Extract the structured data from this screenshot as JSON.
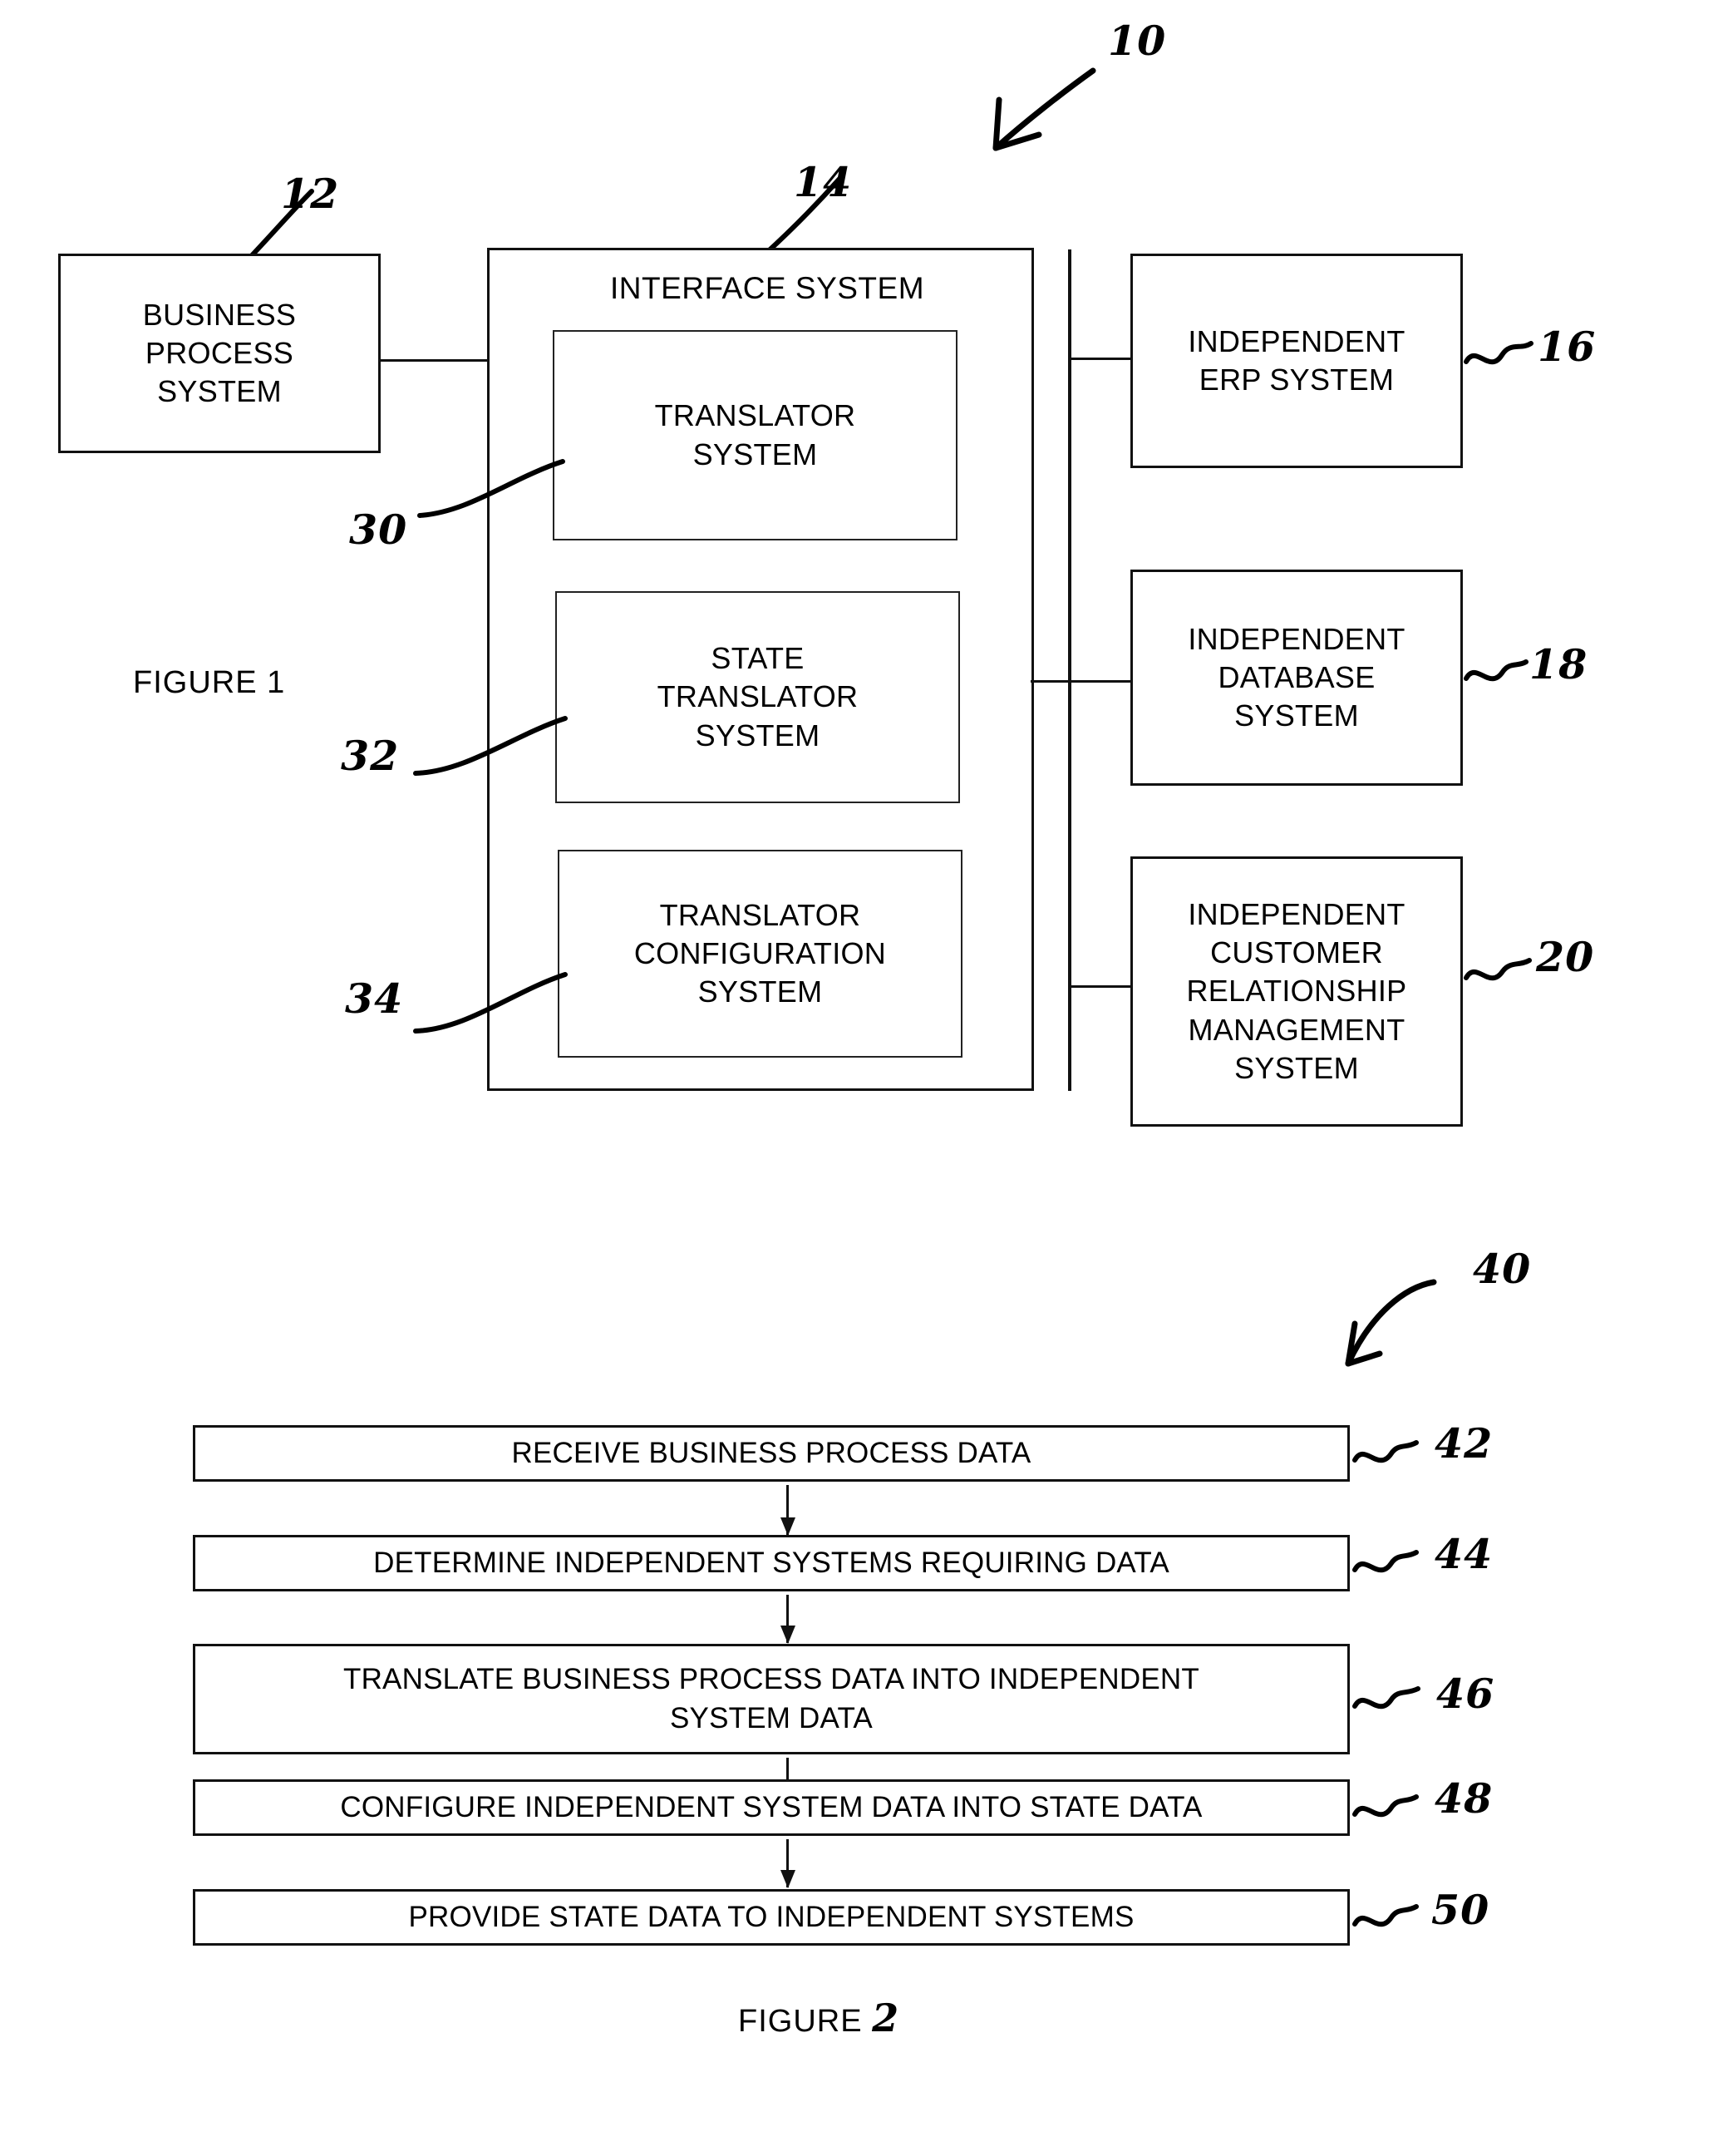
{
  "figure1": {
    "caption": "FIGURE 1",
    "system_ref": "10",
    "blocks": {
      "business_process": {
        "label": "BUSINESS\nPROCESS\nSYSTEM",
        "ref": "12"
      },
      "interface_system": {
        "title": "INTERFACE SYSTEM",
        "ref": "14"
      },
      "translator_system": {
        "label": "TRANSLATOR\nSYSTEM",
        "ref": "30"
      },
      "state_translator_system": {
        "label": "STATE\nTRANSLATOR\nSYSTEM",
        "ref": "32"
      },
      "translator_configuration_system": {
        "label": "TRANSLATOR\nCONFIGURATION\nSYSTEM",
        "ref": "34"
      },
      "independent_erp": {
        "label": "INDEPENDENT\nERP SYSTEM",
        "ref": "16"
      },
      "independent_database": {
        "label": "INDEPENDENT\nDATABASE\nSYSTEM",
        "ref": "18"
      },
      "independent_crm": {
        "label": "INDEPENDENT\nCUSTOMER\nRELATIONSHIP\nMANAGEMENT\nSYSTEM",
        "ref": "20"
      }
    }
  },
  "figure2": {
    "caption_prefix": "FIGURE ",
    "caption_number": "2",
    "method_ref": "40",
    "steps": [
      {
        "label": "RECEIVE BUSINESS PROCESS DATA",
        "ref": "42"
      },
      {
        "label": "DETERMINE INDEPENDENT SYSTEMS REQUIRING DATA",
        "ref": "44"
      },
      {
        "label": "TRANSLATE BUSINESS PROCESS DATA INTO INDEPENDENT\nSYSTEM DATA",
        "ref": "46"
      },
      {
        "label": "CONFIGURE INDEPENDENT SYSTEM DATA INTO STATE DATA",
        "ref": "48"
      },
      {
        "label": "PROVIDE STATE DATA TO INDEPENDENT SYSTEMS",
        "ref": "50"
      }
    ]
  },
  "colors": {
    "ink": "#000000",
    "paper": "#ffffff"
  }
}
